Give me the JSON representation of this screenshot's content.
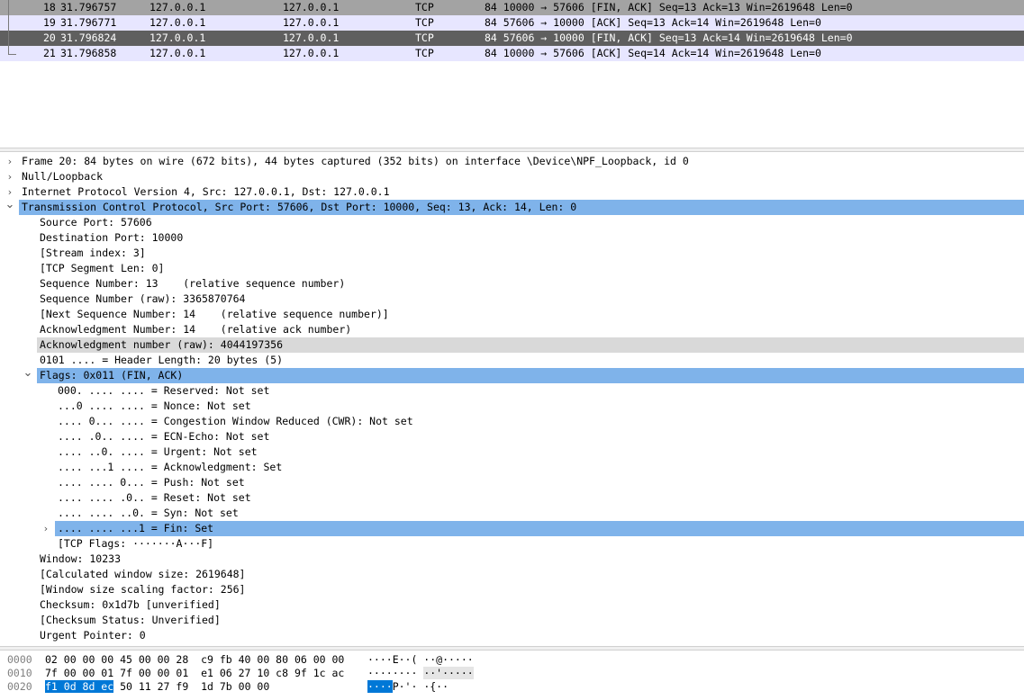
{
  "packet_list": {
    "rows": [
      {
        "no": "18",
        "time": "31.796757",
        "src": "127.0.0.1",
        "dst": "127.0.0.1",
        "proto": "TCP",
        "info": "84 10000 → 57606 [FIN, ACK] Seq=13 Ack=13 Win=2619648 Len=0",
        "style": "fin-gray"
      },
      {
        "no": "19",
        "time": "31.796771",
        "src": "127.0.0.1",
        "dst": "127.0.0.1",
        "proto": "TCP",
        "info": "84 57606 → 10000 [ACK] Seq=13 Ack=14 Win=2619648 Len=0",
        "style": "ack-lav"
      },
      {
        "no": "20",
        "time": "31.796824",
        "src": "127.0.0.1",
        "dst": "127.0.0.1",
        "proto": "TCP",
        "info": "84 57606 → 10000 [FIN, ACK] Seq=13 Ack=14 Win=2619648 Len=0",
        "style": "selected-dark"
      },
      {
        "no": "21",
        "time": "31.796858",
        "src": "127.0.0.1",
        "dst": "127.0.0.1",
        "proto": "TCP",
        "info": "84 10000 → 57606 [ACK] Seq=14 Ack=14 Win=2619648 Len=0",
        "style": "ack-lav"
      }
    ]
  },
  "detail_tree": {
    "rows": [
      {
        "text": "Frame 20: 84 bytes on wire (672 bits), 44 bytes captured (352 bits) on interface \\Device\\NPF_Loopback, id 0",
        "level": 0,
        "expander": "collapsed"
      },
      {
        "text": "Null/Loopback",
        "level": 0,
        "expander": "collapsed"
      },
      {
        "text": "Internet Protocol Version 4, Src: 127.0.0.1, Dst: 127.0.0.1",
        "level": 0,
        "expander": "collapsed"
      },
      {
        "text": "Transmission Control Protocol, Src Port: 57606, Dst Port: 10000, Seq: 13, Ack: 14, Len: 0",
        "level": 0,
        "expander": "expanded",
        "state": "selected"
      },
      {
        "text": "Source Port: 57606",
        "level": 1
      },
      {
        "text": "Destination Port: 10000",
        "level": 1
      },
      {
        "text": "[Stream index: 3]",
        "level": 1
      },
      {
        "text": "[TCP Segment Len: 0]",
        "level": 1
      },
      {
        "text": "Sequence Number: 13    (relative sequence number)",
        "level": 1
      },
      {
        "text": "Sequence Number (raw): 3365870764",
        "level": 1
      },
      {
        "text": "[Next Sequence Number: 14    (relative sequence number)]",
        "level": 1
      },
      {
        "text": "Acknowledgment Number: 14    (relative ack number)",
        "level": 1
      },
      {
        "text": "Acknowledgment number (raw): 4044197356",
        "level": 1,
        "state": "hover"
      },
      {
        "text": "0101 .... = Header Length: 20 bytes (5)",
        "level": 1
      },
      {
        "text": "Flags: 0x011 (FIN, ACK)",
        "level": 1,
        "expander": "expanded",
        "state": "selected"
      },
      {
        "text": "000. .... .... = Reserved: Not set",
        "level": 2
      },
      {
        "text": "...0 .... .... = Nonce: Not set",
        "level": 2
      },
      {
        "text": ".... 0... .... = Congestion Window Reduced (CWR): Not set",
        "level": 2
      },
      {
        "text": ".... .0.. .... = ECN-Echo: Not set",
        "level": 2
      },
      {
        "text": ".... ..0. .... = Urgent: Not set",
        "level": 2
      },
      {
        "text": ".... ...1 .... = Acknowledgment: Set",
        "level": 2
      },
      {
        "text": ".... .... 0... = Push: Not set",
        "level": 2
      },
      {
        "text": ".... .... .0.. = Reset: Not set",
        "level": 2
      },
      {
        "text": ".... .... ..0. = Syn: Not set",
        "level": 2
      },
      {
        "text": ".... .... ...1 = Fin: Set",
        "level": 2,
        "expander": "collapsed",
        "state": "selected"
      },
      {
        "text": "[TCP Flags: ·······A···F]",
        "level": 2
      },
      {
        "text": "Window: 10233",
        "level": 1
      },
      {
        "text": "[Calculated window size: 2619648]",
        "level": 1
      },
      {
        "text": "[Window size scaling factor: 256]",
        "level": 1
      },
      {
        "text": "Checksum: 0x1d7b [unverified]",
        "level": 1
      },
      {
        "text": "[Checksum Status: Unverified]",
        "level": 1
      },
      {
        "text": "Urgent Pointer: 0",
        "level": 1
      }
    ]
  },
  "hex_dump": {
    "rows": [
      {
        "offset": "0000",
        "hex_sel": "",
        "hex_rest": "02 00 00 00 45 00 00 28  c9 fb 40 00 80 06 00 00",
        "ascii_sel": "",
        "ascii_rest": "····E··( ··@·····",
        "ascii_dim": ""
      },
      {
        "offset": "0010",
        "hex_sel": "",
        "hex_rest": "7f 00 00 01 7f 00 00 01  e1 06 27 10 c8 9f 1c ac",
        "ascii_sel": "",
        "ascii_rest": "········ ",
        "ascii_dim": "··'·····"
      },
      {
        "offset": "0020",
        "hex_sel": "f1 0d 8d ec",
        "hex_rest": " 50 11 27 f9  1d 7b 00 00",
        "ascii_sel": "····",
        "ascii_rest": "P·'· ·{··",
        "ascii_dim": ""
      }
    ]
  },
  "colors": {
    "fin_gray_row": "#a3a3a3",
    "ack_row": "#e7e6ff",
    "selected_packet_row": "#5f5f5f",
    "tree_selection": "#7fb3ea",
    "hex_selection": "#0078d7"
  },
  "icons": {
    "collapsed": "chevron-right-icon",
    "expanded": "chevron-down-icon"
  }
}
